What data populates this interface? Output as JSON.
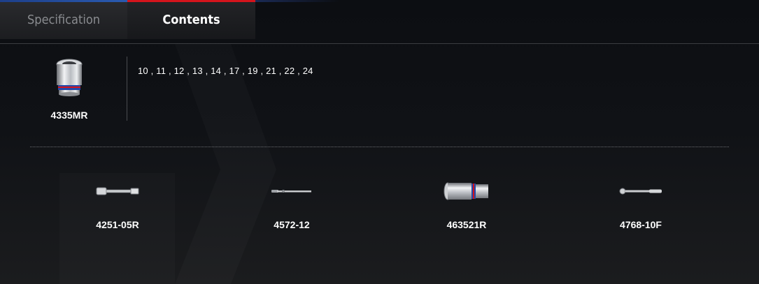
{
  "tabs": [
    {
      "label": "Specification",
      "active": false
    },
    {
      "label": "Contents",
      "active": true
    }
  ],
  "main_item": {
    "code": "4335MR",
    "icon": "socket-icon",
    "sizes": "10 , 11 , 12 , 13 , 14 , 17 , 19 , 21 , 22 , 24"
  },
  "accessories": [
    {
      "code": "4251-05R",
      "icon": "extension-bar-icon"
    },
    {
      "code": "4572-12",
      "icon": "spinner-handle-icon"
    },
    {
      "code": "463521R",
      "icon": "deep-socket-icon"
    },
    {
      "code": "4768-10F",
      "icon": "ratchet-icon"
    }
  ],
  "colors": {
    "active_tab_accent": "#d4141c",
    "inactive_tab_accent": "#2a5bb0",
    "background": "#0c0e12"
  }
}
